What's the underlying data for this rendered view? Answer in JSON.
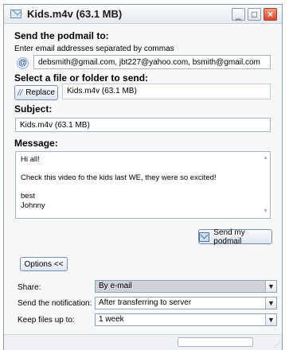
{
  "window": {
    "title": "Kids.m4v (63.1 MB)",
    "controls": {
      "minimize": "_",
      "maximize": "□",
      "close": "×"
    }
  },
  "send_to": {
    "heading": "Send the podmail to:",
    "hint": "Enter email addresses separated by commas",
    "icon": "at-icon",
    "recipients": "debsmith@gmail.com, jbt227@yahoo.com, bsmith@gmail.com"
  },
  "file": {
    "heading": "Select a file or folder to send:",
    "replace_label": "Replace",
    "selected": "Kids.m4v (63.1 MB)"
  },
  "subject": {
    "heading": "Subject:",
    "value": "Kids.m4v (63.1 MB)"
  },
  "message": {
    "heading": "Message:",
    "lines": [
      "Hi all!",
      "",
      "Check this video fo the kids last WE, they were so excited!",
      "",
      "best",
      "Johnny"
    ]
  },
  "send_button": {
    "label": "Send my podmail",
    "icon": "send-mail-icon"
  },
  "options_button": {
    "label": "Options <<"
  },
  "options": {
    "share": {
      "label": "Share:",
      "value": "By e-mail"
    },
    "notification": {
      "label": "Send the notification:",
      "value": "After transferring to server"
    },
    "keep_files": {
      "label": "Keep files up to:",
      "value": "1 week"
    }
  },
  "colors": {
    "accent": "#7a8db0",
    "close": "#d9472b",
    "active_select": "#cfd3d9"
  }
}
